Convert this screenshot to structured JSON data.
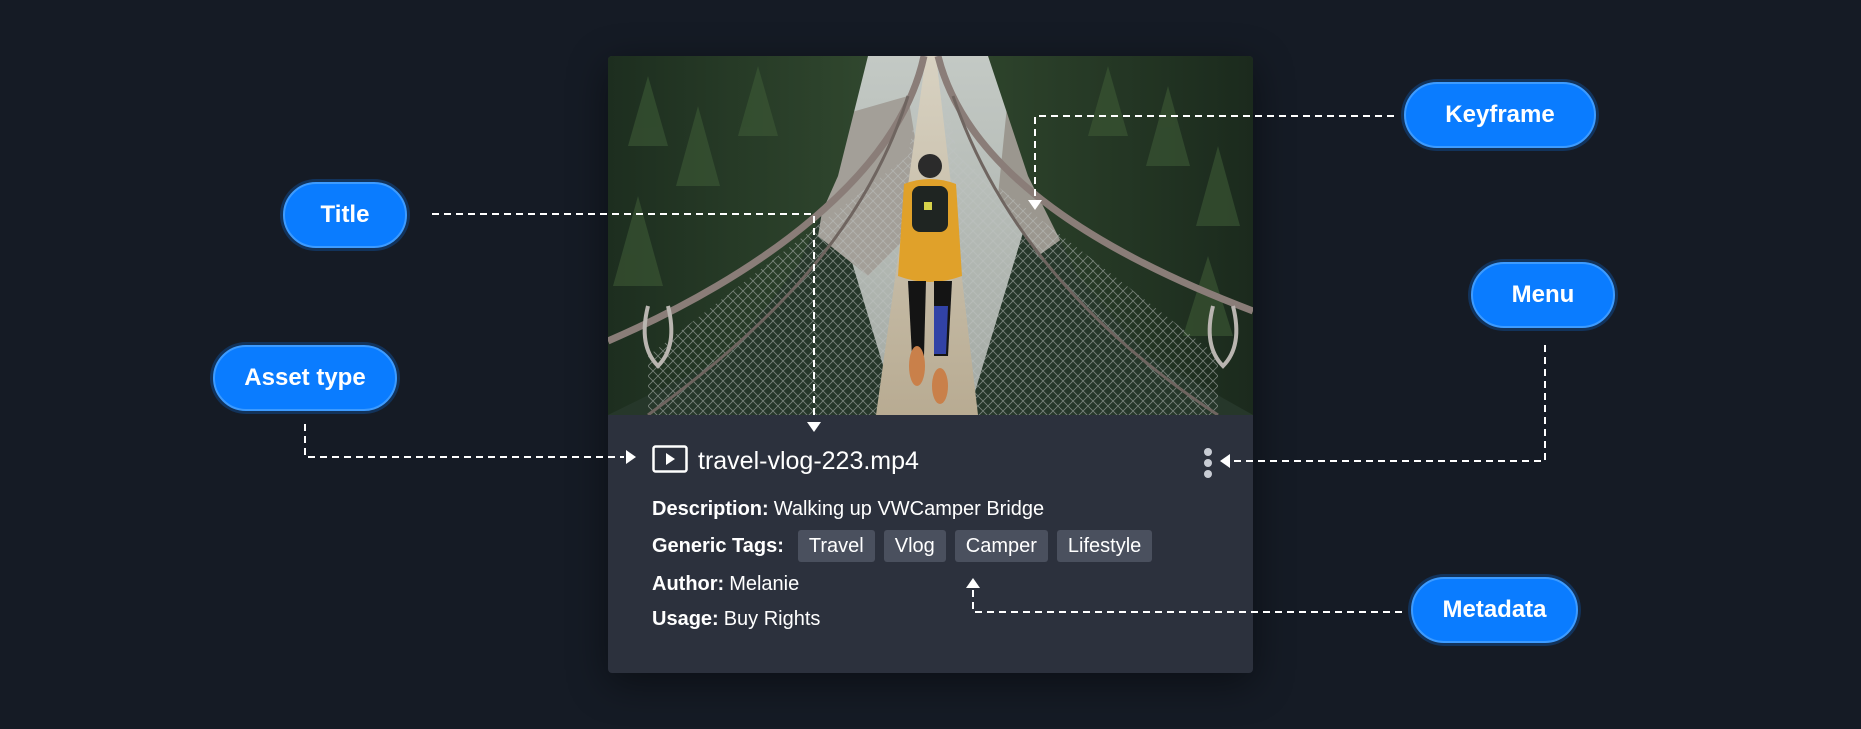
{
  "card": {
    "title": "travel-vlog-223.mp4",
    "metadata": {
      "description": {
        "key": "Description:",
        "value": "Walking up VWCamper Bridge"
      },
      "generic_tags": {
        "key": "Generic Tags:",
        "tags": [
          "Travel",
          "Vlog",
          "Camper",
          "Lifestyle"
        ]
      },
      "author": {
        "key": "Author:",
        "value": "Melanie"
      },
      "usage": {
        "key": "Usage:",
        "value": "Buy Rights"
      }
    },
    "asset_type_icon": "video-play-icon",
    "menu_icon": "vertical-ellipsis-icon"
  },
  "callouts": {
    "title": "Title",
    "asset_type": "Asset type",
    "keyframe": "Keyframe",
    "menu": "Menu",
    "metadata": "Metadata"
  },
  "colors": {
    "background": "#151b25",
    "card": "#2c313d",
    "tag": "#4a505e",
    "accent": "#0a7cff"
  }
}
